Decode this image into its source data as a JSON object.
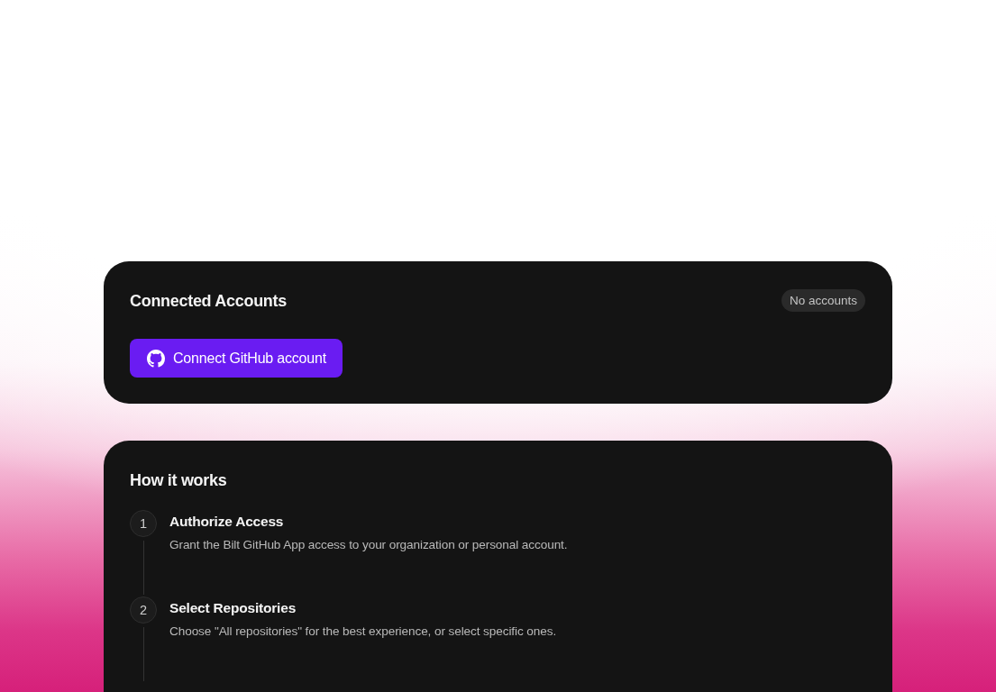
{
  "connected_accounts": {
    "title": "Connected Accounts",
    "badge": "No accounts",
    "button": {
      "label": "Connect GitHub account"
    }
  },
  "how_it_works": {
    "title": "How it works",
    "steps": [
      {
        "number": "1",
        "title": "Authorize Access",
        "description": "Grant the Bilt GitHub App access to your organization or personal account."
      },
      {
        "number": "2",
        "title": "Select Repositories",
        "description": "Choose \"All repositories\" for the best experience, or select specific ones."
      }
    ]
  }
}
